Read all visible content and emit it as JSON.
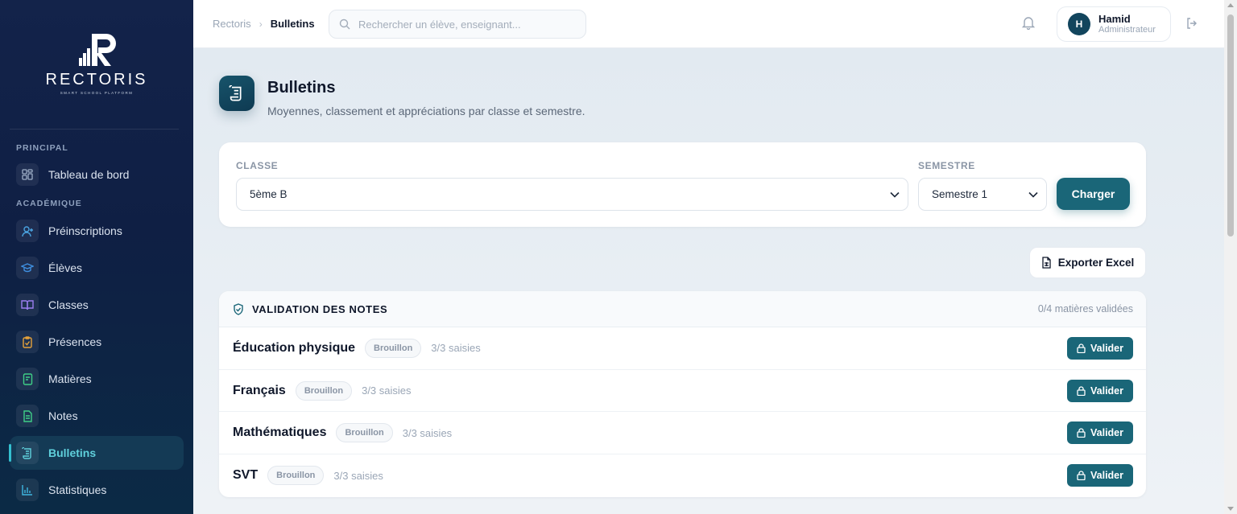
{
  "brand": {
    "name": "RECTORIS",
    "tagline": "SMART SCHOOL PLATFORM"
  },
  "sidebar": {
    "section_principal": "PRINCIPAL",
    "section_academique": "ACADÉMIQUE",
    "items": [
      {
        "label": "Tableau de bord",
        "icon": "dashboard-icon"
      },
      {
        "label": "Préinscriptions",
        "icon": "user-plus-icon"
      },
      {
        "label": "Élèves",
        "icon": "graduation-cap-icon"
      },
      {
        "label": "Classes",
        "icon": "book-open-icon"
      },
      {
        "label": "Présences",
        "icon": "clipboard-check-icon"
      },
      {
        "label": "Matières",
        "icon": "book-icon"
      },
      {
        "label": "Notes",
        "icon": "file-text-icon"
      },
      {
        "label": "Bulletins",
        "icon": "scroll-icon",
        "active": true
      },
      {
        "label": "Statistiques",
        "icon": "bar-chart-icon"
      }
    ]
  },
  "topbar": {
    "breadcrumb": [
      "Rectoris",
      "Bulletins"
    ],
    "search_placeholder": "Rechercher un élève, enseignant...",
    "user": {
      "initial": "H",
      "name": "Hamid",
      "role": "Administrateur"
    }
  },
  "page": {
    "title": "Bulletins",
    "subtitle": "Moyennes, classement et appréciations par classe et semestre."
  },
  "filters": {
    "classe_label": "CLASSE",
    "classe_value": "5ème B",
    "semestre_label": "SEMESTRE",
    "semestre_value": "Semestre 1",
    "charger_label": "Charger"
  },
  "export_label": "Exporter Excel",
  "validation": {
    "title": "VALIDATION DES NOTES",
    "count": "0/4 matières validées",
    "rows": [
      {
        "subject": "Éducation physique",
        "status": "Brouillon",
        "saisies": "3/3 saisies",
        "action": "Valider"
      },
      {
        "subject": "Français",
        "status": "Brouillon",
        "saisies": "3/3 saisies",
        "action": "Valider"
      },
      {
        "subject": "Mathématiques",
        "status": "Brouillon",
        "saisies": "3/3 saisies",
        "action": "Valider"
      },
      {
        "subject": "SVT",
        "status": "Brouillon",
        "saisies": "3/3 saisies",
        "action": "Valider"
      }
    ]
  },
  "colors": {
    "accent": "#1a6678",
    "sidebar_bg": "#13234a",
    "active_text": "#5fd0dc"
  }
}
